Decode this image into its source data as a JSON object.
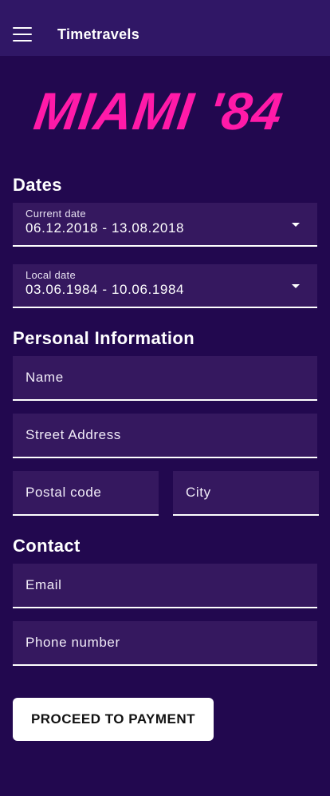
{
  "appbar": {
    "title": "Timetravels",
    "menu_icon": "hamburger-menu-icon"
  },
  "logo": {
    "text": "MIAMI '84",
    "color": "#ff1aa8"
  },
  "dates": {
    "section_title": "Dates",
    "current": {
      "label": "Current date",
      "value": "06.12.2018 - 13.08.2018"
    },
    "local": {
      "label": "Local date",
      "value": "03.06.1984 - 10.06.1984"
    }
  },
  "personal": {
    "section_title": "Personal Information",
    "name_placeholder": "Name",
    "street_placeholder": "Street Address",
    "postal_placeholder": "Postal code",
    "city_placeholder": "City"
  },
  "contact": {
    "section_title": "Contact",
    "email_placeholder": "Email",
    "phone_placeholder": "Phone number"
  },
  "actions": {
    "proceed_label": "PROCEED TO PAYMENT"
  },
  "colors": {
    "background": "#22084f",
    "appbar": "#301766",
    "field": "#35185f",
    "accent": "#ff1aa8"
  }
}
